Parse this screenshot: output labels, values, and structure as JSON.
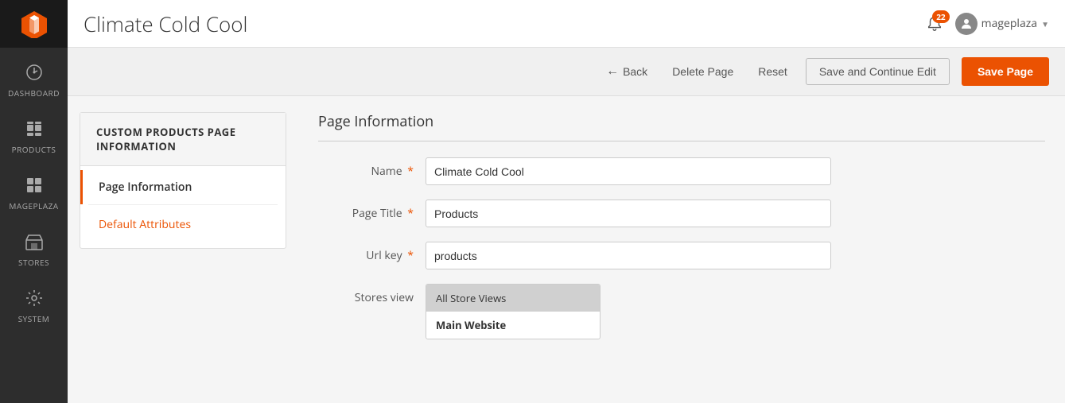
{
  "sidebar": {
    "logo_alt": "Magento Logo",
    "items": [
      {
        "id": "dashboard",
        "label": "Dashboard",
        "icon": "dashboard-icon"
      },
      {
        "id": "products",
        "label": "Products",
        "icon": "products-icon"
      },
      {
        "id": "mageplaza",
        "label": "Mageplaza",
        "icon": "mageplaza-icon"
      },
      {
        "id": "stores",
        "label": "Stores",
        "icon": "stores-icon"
      },
      {
        "id": "system",
        "label": "System",
        "icon": "system-icon"
      }
    ]
  },
  "header": {
    "title": "Climate Cold Cool",
    "notification_count": "22",
    "user_name": "mageplaza"
  },
  "toolbar": {
    "back_label": "Back",
    "delete_label": "Delete Page",
    "reset_label": "Reset",
    "save_continue_label": "Save and Continue Edit",
    "save_label": "Save Page"
  },
  "left_panel": {
    "heading": "CUSTOM PRODUCTS PAGE INFORMATION",
    "menu_items": [
      {
        "id": "page-information",
        "label": "Page Information",
        "active": true
      },
      {
        "id": "default-attributes",
        "label": "Default Attributes",
        "link_style": true
      }
    ]
  },
  "form": {
    "section_title": "Page Information",
    "fields": [
      {
        "id": "name",
        "label": "Name",
        "required": true,
        "value": "Climate Cold Cool",
        "placeholder": ""
      },
      {
        "id": "page_title",
        "label": "Page Title",
        "required": true,
        "value": "Products",
        "placeholder": ""
      },
      {
        "id": "url_key",
        "label": "Url key",
        "required": true,
        "value": "products",
        "placeholder": ""
      }
    ],
    "stores_label": "Stores view",
    "stores_options": [
      {
        "id": "all",
        "label": "All Store Views",
        "selected": true
      },
      {
        "id": "main",
        "label": "Main Website",
        "selected": false
      }
    ]
  }
}
